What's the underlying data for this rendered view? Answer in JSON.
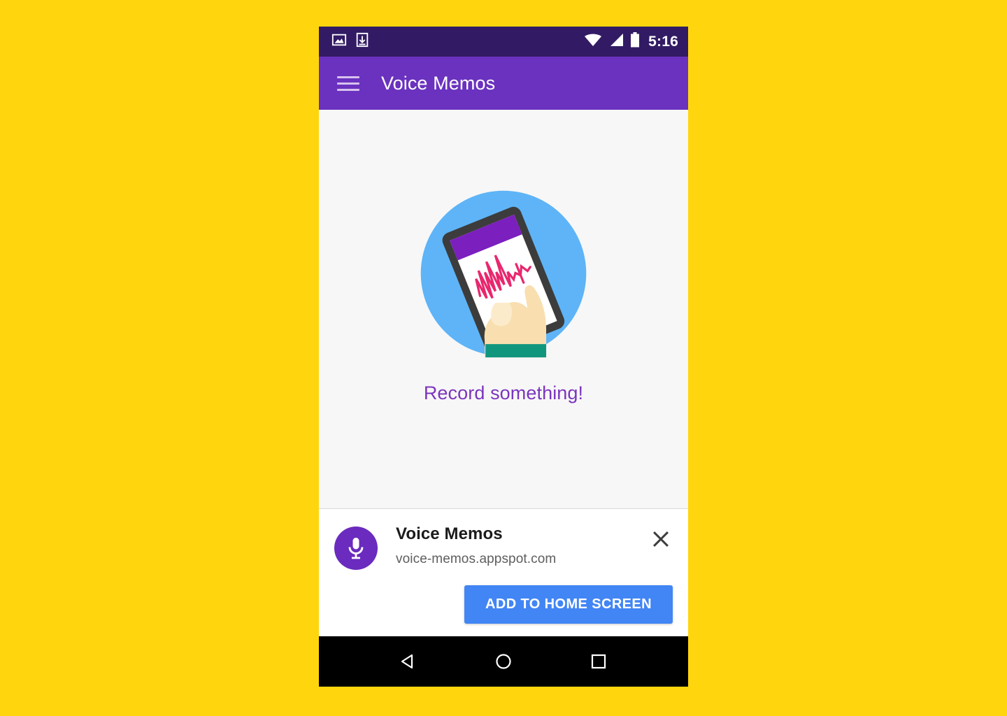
{
  "background_color": "#FFD60D",
  "status_bar": {
    "background_color": "#321B64",
    "time": "5:16",
    "icons": [
      "image-icon",
      "download-icon",
      "wifi-icon",
      "signal-icon",
      "battery-icon"
    ]
  },
  "app_bar": {
    "background_color": "#6A32BE",
    "menu_icon": "hamburger-menu-icon",
    "title": "Voice Memos"
  },
  "content": {
    "background_color": "#F7F7F7",
    "illustration": {
      "name": "hand-holding-phone-illustration",
      "circle_color": "#5EB4F7",
      "phone_body_color": "#3C3C3C",
      "phone_header_color": "#7B1FBE",
      "waveform_color": "#E8276E",
      "skin_color": "#F9DFB0",
      "sleeve_color": "#11967E"
    },
    "empty_state_text": "Record something!",
    "empty_state_color": "#7B35BE"
  },
  "install_banner": {
    "background_color": "#FFFFFF",
    "app_icon": "microphone-icon",
    "app_icon_color": "#6A2BBE",
    "title": "Voice Memos",
    "url": "voice-memos.appspot.com",
    "close_icon": "close-icon",
    "button_label": "ADD TO HOME SCREEN",
    "button_color": "#4285F4"
  },
  "nav_bar": {
    "background_color": "#000000",
    "buttons": [
      {
        "name": "back-button",
        "icon": "triangle-back-icon"
      },
      {
        "name": "home-button",
        "icon": "circle-home-icon"
      },
      {
        "name": "recents-button",
        "icon": "square-recents-icon"
      }
    ]
  }
}
